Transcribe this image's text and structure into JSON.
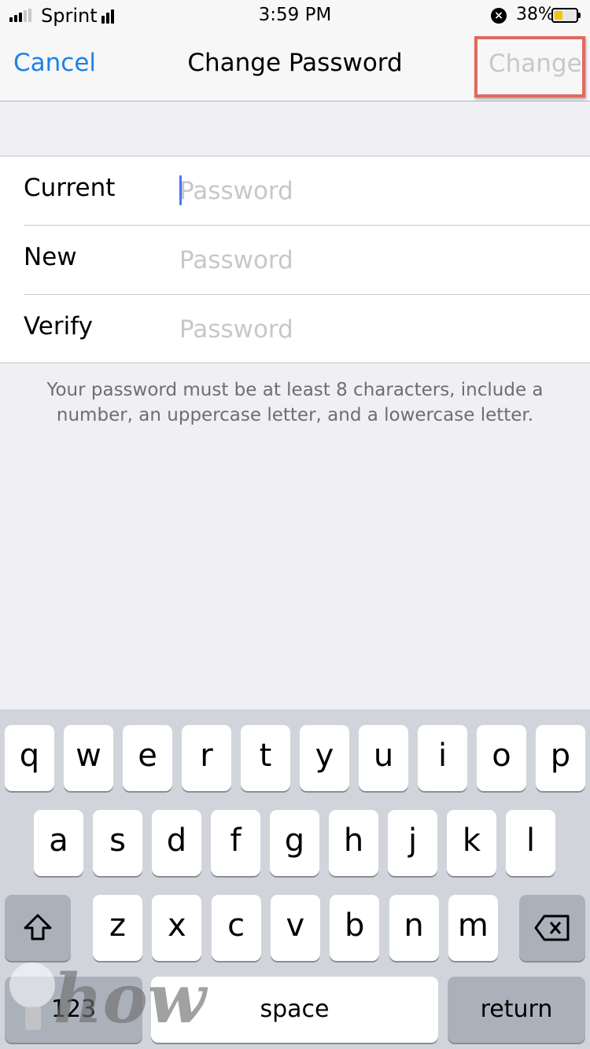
{
  "status_bar": {
    "carrier": "Sprint",
    "time": "3:59 PM",
    "battery_percent_label": "38%",
    "battery_level": 0.38,
    "battery_color": "#f5c400",
    "signal_strength_bars": 3,
    "signal_total_bars": 5,
    "icons": [
      "signal-icon",
      "wifi-icon",
      "do-not-disturb-icon",
      "battery-icon"
    ]
  },
  "nav_bar": {
    "cancel_label": "Cancel",
    "title": "Change Password",
    "change_label": "Change",
    "accent_color": "#1b82e8",
    "highlight_color": "#e0695e"
  },
  "form": {
    "fields": [
      {
        "label": "Current",
        "placeholder": "Password",
        "value": ""
      },
      {
        "label": "New",
        "placeholder": "Password",
        "value": ""
      },
      {
        "label": "Verify",
        "placeholder": "Password",
        "value": ""
      }
    ]
  },
  "hint": "Your password must be at least 8 characters, include a number, an uppercase letter, and a lowercase letter.",
  "keyboard": {
    "row1": [
      "q",
      "w",
      "e",
      "r",
      "t",
      "y",
      "u",
      "i",
      "o",
      "p"
    ],
    "row2": [
      "a",
      "s",
      "d",
      "f",
      "g",
      "h",
      "j",
      "k",
      "l"
    ],
    "row3": [
      "z",
      "x",
      "c",
      "v",
      "b",
      "n",
      "m"
    ],
    "shift_icon": "shift-icon",
    "delete_icon": "delete-icon",
    "numbers_label": "123",
    "space_label": "space",
    "return_label": "return"
  },
  "watermark": {
    "text": "how"
  }
}
